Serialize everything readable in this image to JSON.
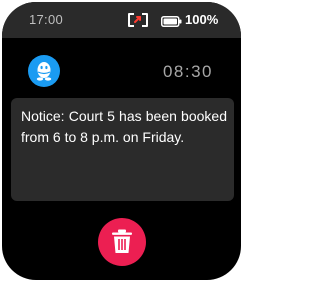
{
  "status_bar": {
    "time": "17:00",
    "call_icon": "call-forward-icon",
    "battery_icon": "battery-icon",
    "battery": "100%"
  },
  "header": {
    "app_icon": "qq-penguin-icon",
    "time": "08:30"
  },
  "notification": {
    "text": "Notice: Court 5 has been booked from 6 to 8 p.m. on Friday."
  },
  "actions": {
    "delete_icon": "trash-icon"
  },
  "colors": {
    "background": "#000000",
    "status_bar": "#2a2a2a",
    "card": "#2b2b2b",
    "app_icon": "#1a9bf2",
    "delete_button": "#ec1f52"
  }
}
